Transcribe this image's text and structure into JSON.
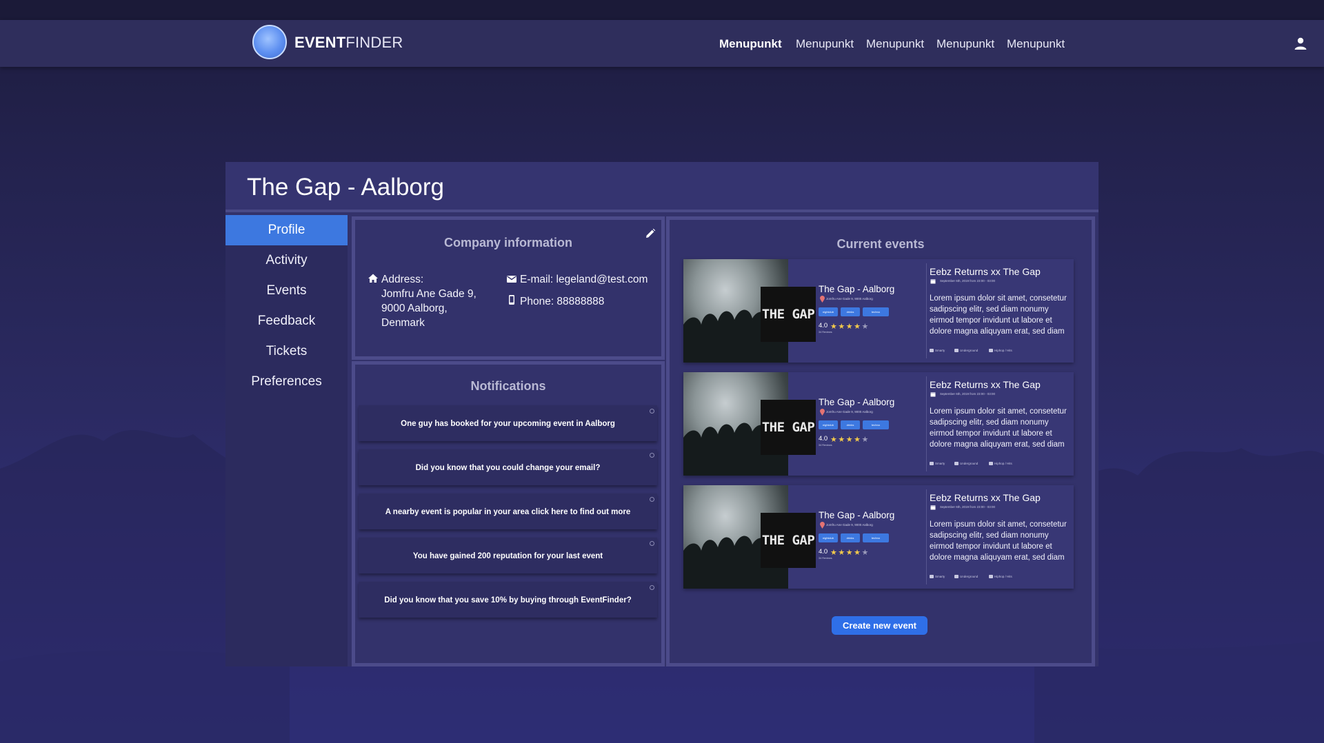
{
  "nav": {
    "brand_bold": "EVENT",
    "brand_light": "FINDER",
    "menu": [
      "Menupunkt",
      "Menupunkt",
      "Menupunkt",
      "Menupunkt",
      "Menupunkt"
    ]
  },
  "page": {
    "title": "The Gap - Aalborg"
  },
  "sidebar": {
    "items": [
      {
        "label": "Profile"
      },
      {
        "label": "Activity"
      },
      {
        "label": "Events"
      },
      {
        "label": "Feedback"
      },
      {
        "label": "Tickets"
      },
      {
        "label": "Preferences"
      }
    ]
  },
  "company": {
    "title": "Company information",
    "address_label": "Address:",
    "address_lines": [
      "Jomfru Ane Gade 9,",
      "9000 Aalborg,",
      "Denmark"
    ],
    "email": "E-mail: legeland@test.com",
    "phone": "Phone: 88888888"
  },
  "notifications": {
    "title": "Notifications",
    "items": [
      "One guy has booked for your upcoming event in Aalborg",
      "Did you know that you could change your email?",
      "A nearby event is popular in your area click here to find out more",
      "You have gained 200 reputation for your last event",
      "Did you know that you save 10% by buying through EventFinder?"
    ]
  },
  "events": {
    "title": "Current events",
    "logo_text": "THE GAP",
    "create_label": "Create new event",
    "items": [
      {
        "venue": "The Gap - Aalborg",
        "address": "Jomfru Ane Gade 9, 9000 Aalborg",
        "tags": [
          "nightclub",
          "drinks",
          "techno"
        ],
        "rating": "4.0",
        "reviews": "34 Reviews",
        "title": "Eebz Returns xx The Gap",
        "date": "September 6th, 2019 from 23:00 - 03:00",
        "description": "Lorem ipsum dolor sit amet, consetetur sadipscing elitr, sed diam nonumy eirmod tempor invidunt ut labore et dolore magna aliquyam erat, sed diam",
        "footer": [
          "Smarty",
          "Underground",
          "Hiphop / Hits"
        ]
      },
      {
        "venue": "The Gap - Aalborg",
        "address": "Jomfru Ane Gade 9, 9000 Aalborg",
        "tags": [
          "nightclub",
          "drinks",
          "techno"
        ],
        "rating": "4.0",
        "reviews": "34 Reviews",
        "title": "Eebz Returns xx The Gap",
        "date": "September 6th, 2019 from 23:00 - 03:00",
        "description": "Lorem ipsum dolor sit amet, consetetur sadipscing elitr, sed diam nonumy eirmod tempor invidunt ut labore et dolore magna aliquyam erat, sed diam",
        "footer": [
          "Smarty",
          "Underground",
          "Hiphop / Hits"
        ]
      },
      {
        "venue": "The Gap - Aalborg",
        "address": "Jomfru Ane Gade 9, 9000 Aalborg",
        "tags": [
          "nightclub",
          "drinks",
          "techno"
        ],
        "rating": "4.0",
        "reviews": "34 Reviews",
        "title": "Eebz Returns xx The Gap",
        "date": "September 6th, 2019 from 23:00 - 03:00",
        "description": "Lorem ipsum dolor sit amet, consetetur sadipscing elitr, sed diam nonumy eirmod tempor invidunt ut labore et dolore magna aliquyam erat, sed diam",
        "footer": [
          "Smarty",
          "Underground",
          "Hiphop / Hits"
        ]
      }
    ]
  },
  "icons": {
    "edit": "pencil-icon",
    "address": "home-icon",
    "email": "mail-icon",
    "phone": "phone-icon",
    "user": "user-icon"
  },
  "colors": {
    "accent": "#3d78e0",
    "nav_bg": "#2f2e5c",
    "card_bg": "#33326a",
    "star": "#f2c94c"
  }
}
